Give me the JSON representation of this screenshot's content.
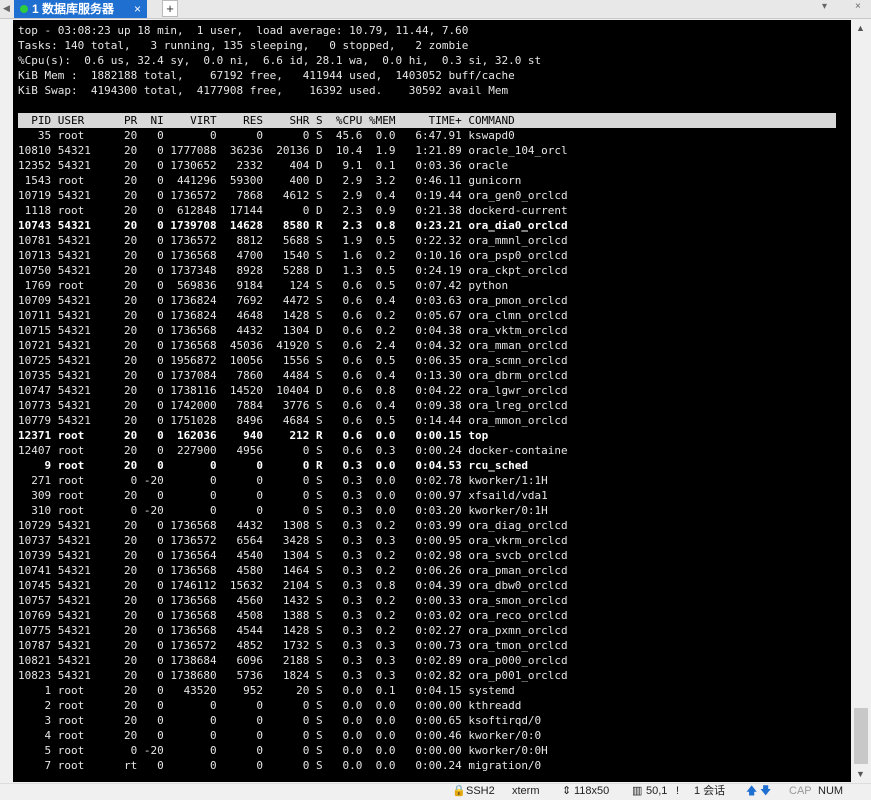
{
  "tabbar": {
    "tab_label": "1 数据库服务器",
    "tab_close": "×",
    "add_tab": "+",
    "window_close": "×",
    "window_menu": "▾"
  },
  "terminal": {
    "summary_lines": [
      "top - 03:08:23 up 18 min,  1 user,  load average: 10.79, 11.44, 7.60",
      "Tasks: 140 total,   3 running, 135 sleeping,   0 stopped,   2 zombie",
      "%Cpu(s):  0.6 us, 32.4 sy,  0.0 ni,  6.6 id, 28.1 wa,  0.0 hi,  0.3 si, 32.0 st",
      "KiB Mem :  1882188 total,    67192 free,   411944 used,  1403052 buff/cache",
      "KiB Swap:  4194300 total,  4177908 free,    16392 used.    30592 avail Mem"
    ],
    "column_header": "  PID USER      PR  NI    VIRT    RES    SHR S  %CPU %MEM     TIME+ COMMAND",
    "processes": [
      {
        "pid": "35",
        "user": "root",
        "pr": "20",
        "ni": "0",
        "virt": "0",
        "res": "0",
        "shr": "0",
        "s": "S",
        "cpu": "45.6",
        "mem": "0.0",
        "time": "6:47.91",
        "cmd": "kswapd0",
        "bold": false
      },
      {
        "pid": "10810",
        "user": "54321",
        "pr": "20",
        "ni": "0",
        "virt": "1777088",
        "res": "36236",
        "shr": "20136",
        "s": "D",
        "cpu": "10.4",
        "mem": "1.9",
        "time": "1:21.89",
        "cmd": "oracle_104_orcl",
        "bold": false
      },
      {
        "pid": "12352",
        "user": "54321",
        "pr": "20",
        "ni": "0",
        "virt": "1730652",
        "res": "2332",
        "shr": "404",
        "s": "D",
        "cpu": "9.1",
        "mem": "0.1",
        "time": "0:03.36",
        "cmd": "oracle",
        "bold": false
      },
      {
        "pid": "1543",
        "user": "root",
        "pr": "20",
        "ni": "0",
        "virt": "441296",
        "res": "59300",
        "shr": "400",
        "s": "D",
        "cpu": "2.9",
        "mem": "3.2",
        "time": "0:46.11",
        "cmd": "gunicorn",
        "bold": false
      },
      {
        "pid": "10719",
        "user": "54321",
        "pr": "20",
        "ni": "0",
        "virt": "1736572",
        "res": "7868",
        "shr": "4612",
        "s": "S",
        "cpu": "2.9",
        "mem": "0.4",
        "time": "0:19.44",
        "cmd": "ora_gen0_orclcd",
        "bold": false
      },
      {
        "pid": "1118",
        "user": "root",
        "pr": "20",
        "ni": "0",
        "virt": "612848",
        "res": "17144",
        "shr": "0",
        "s": "D",
        "cpu": "2.3",
        "mem": "0.9",
        "time": "0:21.38",
        "cmd": "dockerd-current",
        "bold": false
      },
      {
        "pid": "10743",
        "user": "54321",
        "pr": "20",
        "ni": "0",
        "virt": "1739708",
        "res": "14628",
        "shr": "8580",
        "s": "R",
        "cpu": "2.3",
        "mem": "0.8",
        "time": "0:23.21",
        "cmd": "ora_dia0_orclcd",
        "bold": true
      },
      {
        "pid": "10781",
        "user": "54321",
        "pr": "20",
        "ni": "0",
        "virt": "1736572",
        "res": "8812",
        "shr": "5688",
        "s": "S",
        "cpu": "1.9",
        "mem": "0.5",
        "time": "0:22.32",
        "cmd": "ora_mmnl_orclcd",
        "bold": false
      },
      {
        "pid": "10713",
        "user": "54321",
        "pr": "20",
        "ni": "0",
        "virt": "1736568",
        "res": "4700",
        "shr": "1540",
        "s": "S",
        "cpu": "1.6",
        "mem": "0.2",
        "time": "0:10.16",
        "cmd": "ora_psp0_orclcd",
        "bold": false
      },
      {
        "pid": "10750",
        "user": "54321",
        "pr": "20",
        "ni": "0",
        "virt": "1737348",
        "res": "8928",
        "shr": "5288",
        "s": "D",
        "cpu": "1.3",
        "mem": "0.5",
        "time": "0:24.19",
        "cmd": "ora_ckpt_orclcd",
        "bold": false
      },
      {
        "pid": "1769",
        "user": "root",
        "pr": "20",
        "ni": "0",
        "virt": "569836",
        "res": "9184",
        "shr": "124",
        "s": "S",
        "cpu": "0.6",
        "mem": "0.5",
        "time": "0:07.42",
        "cmd": "python",
        "bold": false
      },
      {
        "pid": "10709",
        "user": "54321",
        "pr": "20",
        "ni": "0",
        "virt": "1736824",
        "res": "7692",
        "shr": "4472",
        "s": "S",
        "cpu": "0.6",
        "mem": "0.4",
        "time": "0:03.63",
        "cmd": "ora_pmon_orclcd",
        "bold": false
      },
      {
        "pid": "10711",
        "user": "54321",
        "pr": "20",
        "ni": "0",
        "virt": "1736824",
        "res": "4648",
        "shr": "1428",
        "s": "S",
        "cpu": "0.6",
        "mem": "0.2",
        "time": "0:05.67",
        "cmd": "ora_clmn_orclcd",
        "bold": false
      },
      {
        "pid": "10715",
        "user": "54321",
        "pr": "20",
        "ni": "0",
        "virt": "1736568",
        "res": "4432",
        "shr": "1304",
        "s": "D",
        "cpu": "0.6",
        "mem": "0.2",
        "time": "0:04.38",
        "cmd": "ora_vktm_orclcd",
        "bold": false
      },
      {
        "pid": "10721",
        "user": "54321",
        "pr": "20",
        "ni": "0",
        "virt": "1736568",
        "res": "45036",
        "shr": "41920",
        "s": "S",
        "cpu": "0.6",
        "mem": "2.4",
        "time": "0:04.32",
        "cmd": "ora_mman_orclcd",
        "bold": false
      },
      {
        "pid": "10725",
        "user": "54321",
        "pr": "20",
        "ni": "0",
        "virt": "1956872",
        "res": "10056",
        "shr": "1556",
        "s": "S",
        "cpu": "0.6",
        "mem": "0.5",
        "time": "0:06.35",
        "cmd": "ora_scmn_orclcd",
        "bold": false
      },
      {
        "pid": "10735",
        "user": "54321",
        "pr": "20",
        "ni": "0",
        "virt": "1737084",
        "res": "7860",
        "shr": "4484",
        "s": "S",
        "cpu": "0.6",
        "mem": "0.4",
        "time": "0:13.30",
        "cmd": "ora_dbrm_orclcd",
        "bold": false
      },
      {
        "pid": "10747",
        "user": "54321",
        "pr": "20",
        "ni": "0",
        "virt": "1738116",
        "res": "14520",
        "shr": "10404",
        "s": "D",
        "cpu": "0.6",
        "mem": "0.8",
        "time": "0:04.22",
        "cmd": "ora_lgwr_orclcd",
        "bold": false
      },
      {
        "pid": "10773",
        "user": "54321",
        "pr": "20",
        "ni": "0",
        "virt": "1742000",
        "res": "7884",
        "shr": "3776",
        "s": "S",
        "cpu": "0.6",
        "mem": "0.4",
        "time": "0:09.38",
        "cmd": "ora_lreg_orclcd",
        "bold": false
      },
      {
        "pid": "10779",
        "user": "54321",
        "pr": "20",
        "ni": "0",
        "virt": "1751028",
        "res": "8496",
        "shr": "4684",
        "s": "S",
        "cpu": "0.6",
        "mem": "0.5",
        "time": "0:14.44",
        "cmd": "ora_mmon_orclcd",
        "bold": false
      },
      {
        "pid": "12371",
        "user": "root",
        "pr": "20",
        "ni": "0",
        "virt": "162036",
        "res": "940",
        "shr": "212",
        "s": "R",
        "cpu": "0.6",
        "mem": "0.0",
        "time": "0:00.15",
        "cmd": "top",
        "bold": true
      },
      {
        "pid": "12407",
        "user": "root",
        "pr": "20",
        "ni": "0",
        "virt": "227900",
        "res": "4956",
        "shr": "0",
        "s": "S",
        "cpu": "0.6",
        "mem": "0.3",
        "time": "0:00.24",
        "cmd": "docker-containe",
        "bold": false
      },
      {
        "pid": "9",
        "user": "root",
        "pr": "20",
        "ni": "0",
        "virt": "0",
        "res": "0",
        "shr": "0",
        "s": "R",
        "cpu": "0.3",
        "mem": "0.0",
        "time": "0:04.53",
        "cmd": "rcu_sched",
        "bold": true
      },
      {
        "pid": "271",
        "user": "root",
        "pr": "0",
        "ni": "-20",
        "virt": "0",
        "res": "0",
        "shr": "0",
        "s": "S",
        "cpu": "0.3",
        "mem": "0.0",
        "time": "0:02.78",
        "cmd": "kworker/1:1H",
        "bold": false
      },
      {
        "pid": "309",
        "user": "root",
        "pr": "20",
        "ni": "0",
        "virt": "0",
        "res": "0",
        "shr": "0",
        "s": "S",
        "cpu": "0.3",
        "mem": "0.0",
        "time": "0:00.97",
        "cmd": "xfsaild/vda1",
        "bold": false
      },
      {
        "pid": "310",
        "user": "root",
        "pr": "0",
        "ni": "-20",
        "virt": "0",
        "res": "0",
        "shr": "0",
        "s": "S",
        "cpu": "0.3",
        "mem": "0.0",
        "time": "0:03.20",
        "cmd": "kworker/0:1H",
        "bold": false
      },
      {
        "pid": "10729",
        "user": "54321",
        "pr": "20",
        "ni": "0",
        "virt": "1736568",
        "res": "4432",
        "shr": "1308",
        "s": "S",
        "cpu": "0.3",
        "mem": "0.2",
        "time": "0:03.99",
        "cmd": "ora_diag_orclcd",
        "bold": false
      },
      {
        "pid": "10737",
        "user": "54321",
        "pr": "20",
        "ni": "0",
        "virt": "1736572",
        "res": "6564",
        "shr": "3428",
        "s": "S",
        "cpu": "0.3",
        "mem": "0.3",
        "time": "0:00.95",
        "cmd": "ora_vkrm_orclcd",
        "bold": false
      },
      {
        "pid": "10739",
        "user": "54321",
        "pr": "20",
        "ni": "0",
        "virt": "1736564",
        "res": "4540",
        "shr": "1304",
        "s": "S",
        "cpu": "0.3",
        "mem": "0.2",
        "time": "0:02.98",
        "cmd": "ora_svcb_orclcd",
        "bold": false
      },
      {
        "pid": "10741",
        "user": "54321",
        "pr": "20",
        "ni": "0",
        "virt": "1736568",
        "res": "4580",
        "shr": "1464",
        "s": "S",
        "cpu": "0.3",
        "mem": "0.2",
        "time": "0:06.26",
        "cmd": "ora_pman_orclcd",
        "bold": false
      },
      {
        "pid": "10745",
        "user": "54321",
        "pr": "20",
        "ni": "0",
        "virt": "1746112",
        "res": "15632",
        "shr": "2104",
        "s": "S",
        "cpu": "0.3",
        "mem": "0.8",
        "time": "0:04.39",
        "cmd": "ora_dbw0_orclcd",
        "bold": false
      },
      {
        "pid": "10757",
        "user": "54321",
        "pr": "20",
        "ni": "0",
        "virt": "1736568",
        "res": "4560",
        "shr": "1432",
        "s": "S",
        "cpu": "0.3",
        "mem": "0.2",
        "time": "0:00.33",
        "cmd": "ora_smon_orclcd",
        "bold": false
      },
      {
        "pid": "10769",
        "user": "54321",
        "pr": "20",
        "ni": "0",
        "virt": "1736568",
        "res": "4508",
        "shr": "1388",
        "s": "S",
        "cpu": "0.3",
        "mem": "0.2",
        "time": "0:03.02",
        "cmd": "ora_reco_orclcd",
        "bold": false
      },
      {
        "pid": "10775",
        "user": "54321",
        "pr": "20",
        "ni": "0",
        "virt": "1736568",
        "res": "4544",
        "shr": "1428",
        "s": "S",
        "cpu": "0.3",
        "mem": "0.2",
        "time": "0:02.27",
        "cmd": "ora_pxmn_orclcd",
        "bold": false
      },
      {
        "pid": "10787",
        "user": "54321",
        "pr": "20",
        "ni": "0",
        "virt": "1736572",
        "res": "4852",
        "shr": "1732",
        "s": "S",
        "cpu": "0.3",
        "mem": "0.3",
        "time": "0:00.73",
        "cmd": "ora_tmon_orclcd",
        "bold": false
      },
      {
        "pid": "10821",
        "user": "54321",
        "pr": "20",
        "ni": "0",
        "virt": "1738684",
        "res": "6096",
        "shr": "2188",
        "s": "S",
        "cpu": "0.3",
        "mem": "0.3",
        "time": "0:02.89",
        "cmd": "ora_p000_orclcd",
        "bold": false
      },
      {
        "pid": "10823",
        "user": "54321",
        "pr": "20",
        "ni": "0",
        "virt": "1738680",
        "res": "5736",
        "shr": "1824",
        "s": "S",
        "cpu": "0.3",
        "mem": "0.3",
        "time": "0:02.82",
        "cmd": "ora_p001_orclcd",
        "bold": false
      },
      {
        "pid": "1",
        "user": "root",
        "pr": "20",
        "ni": "0",
        "virt": "43520",
        "res": "952",
        "shr": "20",
        "s": "S",
        "cpu": "0.0",
        "mem": "0.1",
        "time": "0:04.15",
        "cmd": "systemd",
        "bold": false
      },
      {
        "pid": "2",
        "user": "root",
        "pr": "20",
        "ni": "0",
        "virt": "0",
        "res": "0",
        "shr": "0",
        "s": "S",
        "cpu": "0.0",
        "mem": "0.0",
        "time": "0:00.00",
        "cmd": "kthreadd",
        "bold": false
      },
      {
        "pid": "3",
        "user": "root",
        "pr": "20",
        "ni": "0",
        "virt": "0",
        "res": "0",
        "shr": "0",
        "s": "S",
        "cpu": "0.0",
        "mem": "0.0",
        "time": "0:00.65",
        "cmd": "ksoftirqd/0",
        "bold": false
      },
      {
        "pid": "4",
        "user": "root",
        "pr": "20",
        "ni": "0",
        "virt": "0",
        "res": "0",
        "shr": "0",
        "s": "S",
        "cpu": "0.0",
        "mem": "0.0",
        "time": "0:00.46",
        "cmd": "kworker/0:0",
        "bold": false
      },
      {
        "pid": "5",
        "user": "root",
        "pr": "0",
        "ni": "-20",
        "virt": "0",
        "res": "0",
        "shr": "0",
        "s": "S",
        "cpu": "0.0",
        "mem": "0.0",
        "time": "0:00.00",
        "cmd": "kworker/0:0H",
        "bold": false
      },
      {
        "pid": "7",
        "user": "root",
        "pr": "rt",
        "ni": "0",
        "virt": "0",
        "res": "0",
        "shr": "0",
        "s": "S",
        "cpu": "0.0",
        "mem": "0.0",
        "time": "0:00.24",
        "cmd": "migration/0",
        "bold": false
      }
    ]
  },
  "statusbar": {
    "protocol": "SSH2",
    "terminal_type": "xterm",
    "size": "118x50",
    "cursor": "50,1",
    "sessions": "1 会话",
    "cap": "CAP",
    "num": "NUM"
  },
  "colors": {
    "tab_active": "#1f6fd1",
    "terminal_bg": "#000000",
    "terminal_fg": "#e6e6e6",
    "header_row_bg": "#d8d8d8",
    "status_up_icon": "#1f6fd1"
  }
}
